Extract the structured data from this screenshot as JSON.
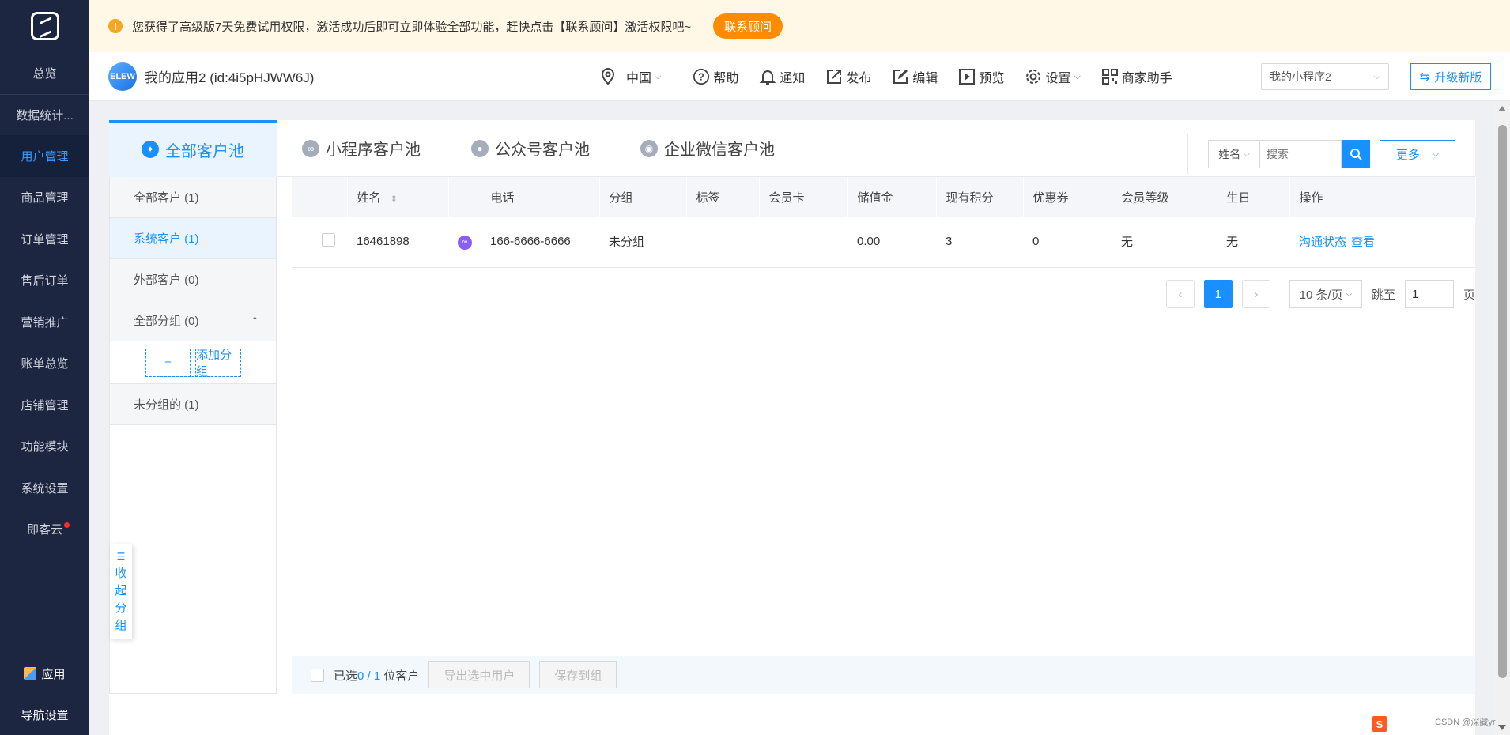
{
  "sidebar": {
    "items": [
      {
        "label": "总览"
      },
      {
        "label": "数据统计..."
      },
      {
        "label": "用户管理"
      },
      {
        "label": "商品管理"
      },
      {
        "label": "订单管理"
      },
      {
        "label": "售后订单"
      },
      {
        "label": "营销推广"
      },
      {
        "label": "账单总览"
      },
      {
        "label": "店铺管理"
      },
      {
        "label": "功能模块"
      },
      {
        "label": "系统设置"
      },
      {
        "label": "即客云"
      }
    ],
    "bottom_app": "应用",
    "bottom_nav": "导航设置"
  },
  "notice": {
    "text": "您获得了高级版7天免费试用权限，激活成功后即可立即体验全部功能，赶快点击【联系顾问】激活权限吧~",
    "button": "联系顾问"
  },
  "topbar": {
    "app_icon_text": "ELEW",
    "app_name": "我的应用2",
    "app_id": "(id:4i5pHJWW6J)",
    "region": "中国",
    "tools": {
      "help": "帮助",
      "notify": "通知",
      "publish": "发布",
      "edit": "编辑",
      "preview": "预览",
      "settings": "设置",
      "assistant": "商家助手"
    },
    "app_select": "我的小程序2",
    "upgrade": "升级新版"
  },
  "tabs": [
    {
      "label": "全部客户池"
    },
    {
      "label": "小程序客户池"
    },
    {
      "label": "公众号客户池"
    },
    {
      "label": "企业微信客户池"
    }
  ],
  "search": {
    "field": "姓名",
    "placeholder": "搜索",
    "more": "更多"
  },
  "groups": {
    "all": "全部客户 (1)",
    "system": "系统客户 (1)",
    "external": "外部客户 (0)",
    "all_groups": "全部分组 (0)",
    "add_group": "添加分组",
    "ungrouped": "未分组的 (1)",
    "collapse": [
      "收",
      "起",
      "分",
      "组"
    ]
  },
  "table": {
    "headers": [
      "姓名",
      "电话",
      "分组",
      "标签",
      "会员卡",
      "储值金",
      "现有积分",
      "优惠券",
      "会员等级",
      "生日",
      "操作"
    ],
    "rows": [
      {
        "name": "16461898",
        "phone": "166-6666-6666",
        "group": "未分组",
        "tag": "",
        "card": "",
        "balance": "0.00",
        "points": "3",
        "coupon": "0",
        "level": "无",
        "birthday": "无",
        "action1": "沟通状态",
        "action2": "查看"
      }
    ]
  },
  "pager": {
    "current": "1",
    "size": "10 条/页",
    "jump_label": "跳至",
    "jump_value": "1",
    "page_unit": "页"
  },
  "footer": {
    "selected_prefix": "已选",
    "selected": "0",
    "slash": "/",
    "total": "1",
    "unit": "位客户",
    "export": "导出选中用户",
    "save_group": "保存到组"
  },
  "watermark": "CSDN @深藏yr",
  "colors": {
    "accent": "#1890ff",
    "sidebar": "#1c2640",
    "notice_btn": "#ff8c00"
  }
}
